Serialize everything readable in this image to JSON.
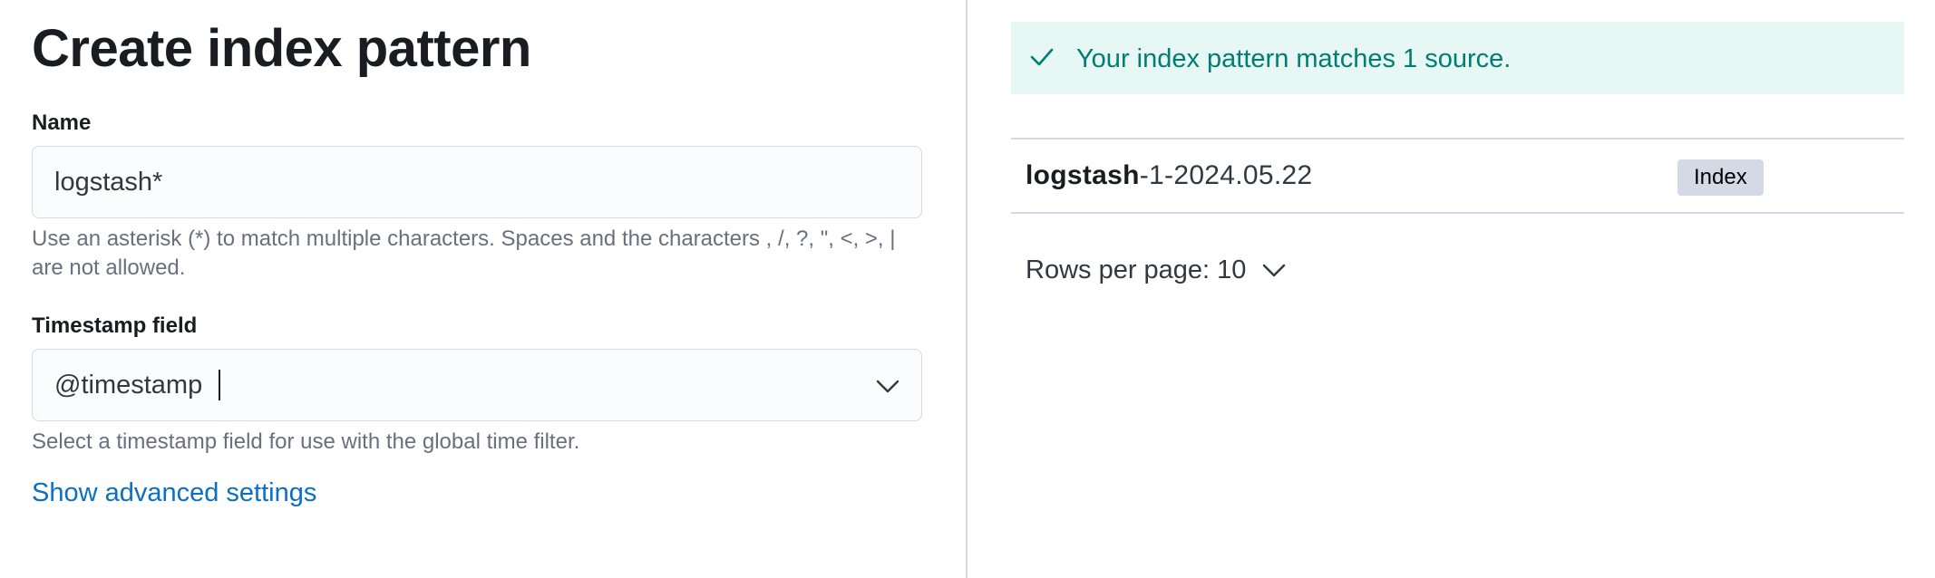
{
  "create_form": {
    "title": "Create index pattern",
    "name_field": {
      "label": "Name",
      "value": "logstash*",
      "help": "Use an asterisk (*) to match multiple characters. Spaces and the characters , /, ?, \", <, >, | are not allowed."
    },
    "timestamp_field": {
      "label": "Timestamp field",
      "value": "@timestamp",
      "help": "Select a timestamp field for use with the global time filter."
    },
    "advanced_link": "Show advanced settings"
  },
  "preview": {
    "callout": {
      "icon": "check-icon",
      "text": "Your index pattern matches 1 source.",
      "color": "#017d73",
      "background": "#e6f7f4"
    },
    "sources": [
      {
        "name_match": "logstash",
        "name_rest": "-1-2024.05.22",
        "type": "Index"
      }
    ],
    "pagination": {
      "label": "Rows per page: 10",
      "icon": "chevron-down-icon"
    }
  },
  "colors": {
    "link": "#0b6fc2",
    "help_text": "#69707d",
    "badge": "#d3dae6"
  }
}
